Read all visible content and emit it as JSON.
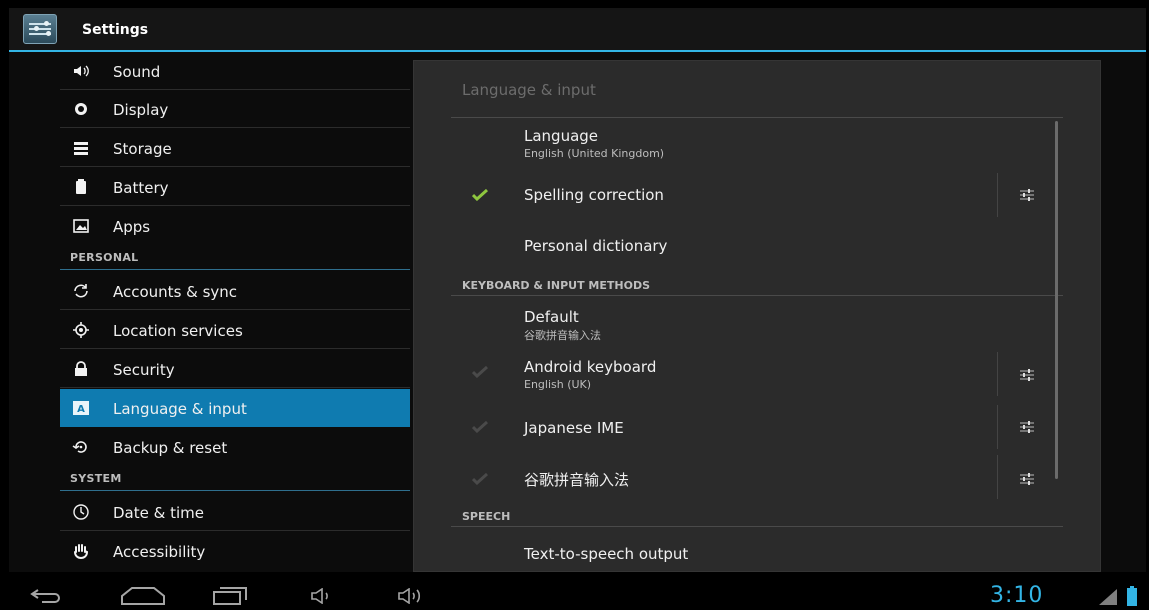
{
  "actionbar": {
    "title": "Settings",
    "icon": "settings-icon"
  },
  "sidebar": {
    "items_top": [
      {
        "label": "Sound",
        "icon": "speaker-icon"
      },
      {
        "label": "Display",
        "icon": "brightness-icon"
      },
      {
        "label": "Storage",
        "icon": "storage-icon"
      },
      {
        "label": "Battery",
        "icon": "battery-icon"
      },
      {
        "label": "Apps",
        "icon": "apps-icon"
      }
    ],
    "personal_header": "PERSONAL",
    "items_personal": [
      {
        "label": "Accounts & sync",
        "icon": "sync-icon"
      },
      {
        "label": "Location services",
        "icon": "location-icon"
      },
      {
        "label": "Security",
        "icon": "lock-icon"
      },
      {
        "label": "Language & input",
        "icon": "language-icon",
        "selected": true
      },
      {
        "label": "Backup & reset",
        "icon": "backup-icon"
      }
    ],
    "system_header": "SYSTEM",
    "items_system": [
      {
        "label": "Date & time",
        "icon": "clock-icon"
      },
      {
        "label": "Accessibility",
        "icon": "hand-icon"
      }
    ]
  },
  "panel": {
    "title": "Language & input",
    "language": {
      "title": "Language",
      "summary": "English (United Kingdom)"
    },
    "spelling": {
      "title": "Spelling correction",
      "checked": true
    },
    "dictionary": {
      "title": "Personal dictionary"
    },
    "keyboard_header": "KEYBOARD & INPUT METHODS",
    "default": {
      "title": "Default",
      "summary": "谷歌拼音输入法"
    },
    "android_keyboard": {
      "title": "Android keyboard",
      "summary": "English (UK)"
    },
    "japanese_ime": {
      "title": "Japanese IME"
    },
    "pinyin": {
      "title": "谷歌拼音输入法"
    },
    "speech_header": "SPEECH",
    "tts": {
      "title": "Text-to-speech output"
    }
  },
  "navbar": {
    "clock": "3:10"
  },
  "colors": {
    "accent": "#33b5e5",
    "selected": "#0f7bb0",
    "check": "#8ec63f"
  }
}
